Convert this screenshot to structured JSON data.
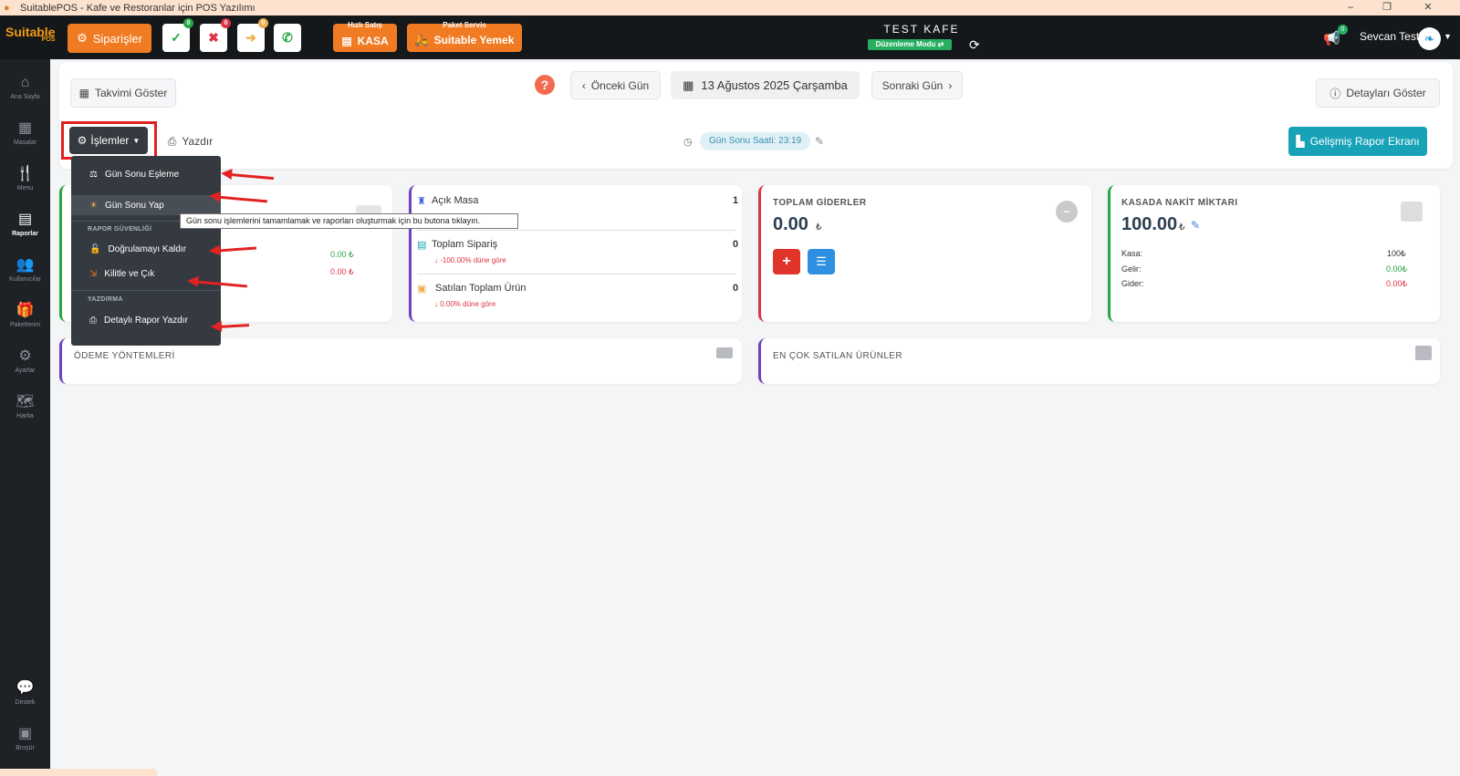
{
  "window": {
    "title": "SuitablePOS - Kafe ve Restoranlar için POS Yazılımı",
    "minimize": "–",
    "maximize": "❐",
    "close": "✕"
  },
  "topbar": {
    "logo_text": "Suitable",
    "logo_sub": "POS",
    "orders_label": "Siparişler",
    "status_buttons": [
      {
        "name": "approve",
        "glyph": "✓",
        "badge": "0",
        "color": "#28a745"
      },
      {
        "name": "cancel",
        "glyph": "✖",
        "badge": "0",
        "color": "#dc3545"
      },
      {
        "name": "forward",
        "glyph": "➜",
        "badge": "0",
        "color": "#f0ad4e"
      },
      {
        "name": "phone",
        "glyph": "✆",
        "badge": "",
        "color": "#28a745"
      }
    ],
    "quick_sale_top": "Hızlı Satış",
    "quick_sale_label": "KASA",
    "delivery_top": "Paket Servis",
    "delivery_label": "Suitable Yemek",
    "cafe_name": "TEST KAFE",
    "edit_mode": "Düzenleme Modu ⇄",
    "notif_badge": "0",
    "user_name": "Sevcan Test"
  },
  "sidebar": [
    {
      "label": "Ana Sayfa",
      "icon": "⌂"
    },
    {
      "label": "Masalar",
      "icon": "▦"
    },
    {
      "label": "Menu",
      "icon": "🍴"
    },
    {
      "label": "Raporlar",
      "icon": "▤"
    },
    {
      "label": "Kullanıcılar",
      "icon": "👥"
    },
    {
      "label": "Paketlerim",
      "icon": "🎁"
    },
    {
      "label": "Ayarlar",
      "icon": "⚙"
    },
    {
      "label": "Harita",
      "icon": "🗺"
    },
    {
      "label": "Destek",
      "icon": "💬"
    },
    {
      "label": "Broşür",
      "icon": "▣"
    }
  ],
  "toolbar": {
    "calendar_btn": "Takvimi Göster",
    "help": "?",
    "prev_day": "Önceki Gün",
    "date": "13 Ağustos 2025 Çarşamba",
    "next_day": "Sonraki Gün",
    "details_btn": "Detayları Göster",
    "operations_btn": "İşlemler",
    "print_btn": "Yazdır",
    "eod_time": "Gün Sonu Saati: 23:19",
    "advanced_report_btn": "Gelişmiş Rapor Ekranı"
  },
  "operations_menu": {
    "item_sync": "Gün Sonu Eşleme",
    "item_eod": "Gün Sonu Yap",
    "header_security": "RAPOR GÜVENLİĞİ",
    "item_remove_auth": "Doğrulamayı Kaldır",
    "item_lock_exit": "Kilitle ve Çık",
    "header_print": "YAZDIRMA",
    "item_detailed_print": "Detaylı Rapor Yazdır"
  },
  "tooltip": "Gün sonu işlemlerini tamamlamak ve raporları oluşturmak için bu butona tıklayın.",
  "card_sales": {
    "line1": "0.00 ₺",
    "line2": "0.00 ₺"
  },
  "card_counts": {
    "open_tables_label": "Açık Masa",
    "open_tables_value": "1",
    "total_orders_label": "Toplam Sipariş",
    "total_orders_value": "0",
    "total_orders_change": "↓ -100.00% düne göre",
    "products_label": "Satılan Toplam Ürün",
    "products_value": "0",
    "products_change": "↓ 0.00% düne göre"
  },
  "card_expenses": {
    "label": "TOPLAM GİDERLER",
    "value": "0.00",
    "currency": "₺",
    "add": "+",
    "list": "☰"
  },
  "card_cash": {
    "label": "KASADA NAKİT MİKTARI",
    "value": "100.00",
    "currency": "₺",
    "kasa_label": "Kasa:",
    "kasa_value": "100₺",
    "income_label": "Gelir:",
    "income_value": "0.00₺",
    "expense_label": "Gider:",
    "expense_value": "0.00₺"
  },
  "payment_methods_title": "ÖDEME YÖNTEMLERİ",
  "top_products_title": "EN ÇOK SATILAN ÜRÜNLER",
  "colors": {
    "accent": "#f07b22",
    "teal": "#17a2b8",
    "dark": "#15181b",
    "highlight": "#e02020"
  }
}
